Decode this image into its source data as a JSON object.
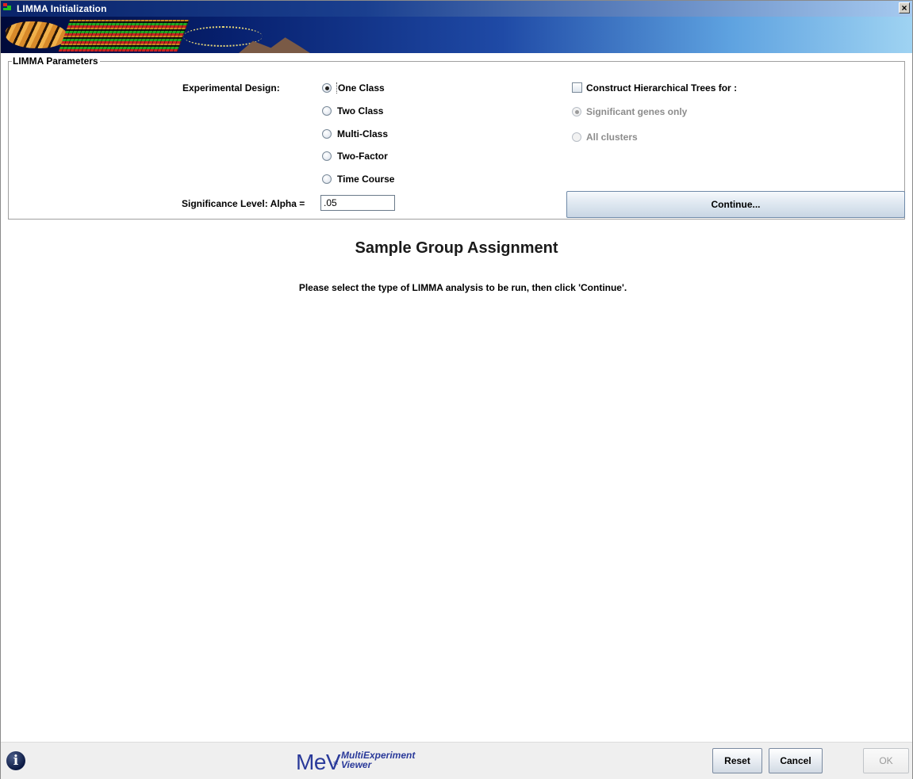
{
  "window": {
    "title": "LIMMA Initialization",
    "close_label": "×"
  },
  "params": {
    "legend": "LIMMA Parameters",
    "design_label": "Experimental Design:",
    "design_options": [
      "One Class",
      "Two Class",
      "Multi-Class",
      "Two-Factor",
      "Time Course"
    ],
    "selected_design": "One Class",
    "alpha_label": "Significance Level: Alpha =",
    "alpha_value": ".05",
    "trees_label": "Construct Hierarchical Trees for :",
    "trees_checked": false,
    "tree_options": [
      "Significant genes only",
      "All clusters"
    ],
    "selected_tree_option": "Significant genes only",
    "continue_label": "Continue..."
  },
  "main": {
    "heading": "Sample Group Assignment",
    "instructions": "Please select the type of LIMMA analysis to be run, then click 'Continue'."
  },
  "footer": {
    "info_glyph": "i",
    "logo_big": "MeV",
    "logo_star": "∗",
    "logo_line1": "MultiExperiment",
    "logo_line2": "Viewer",
    "reset_label": "Reset",
    "cancel_label": "Cancel",
    "ok_label": "OK",
    "ok_enabled": false
  }
}
